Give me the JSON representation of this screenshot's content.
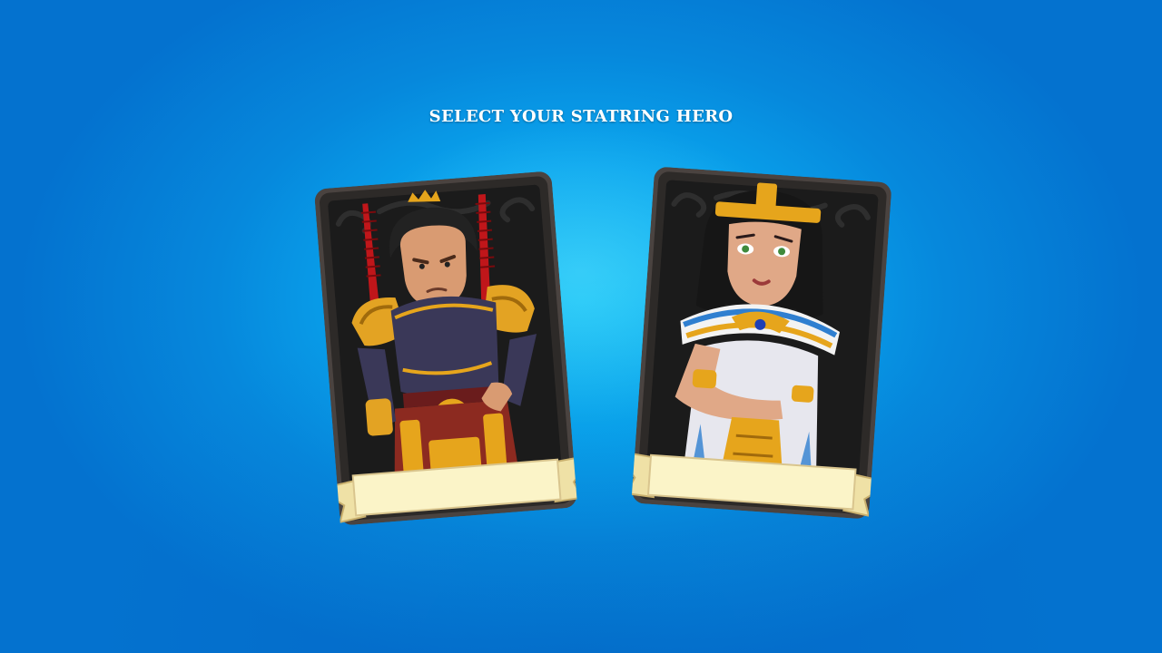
{
  "screen": {
    "title": "SELECT YOUR STATRING HERO"
  },
  "heroes": [
    {
      "id": "warrior",
      "name": "",
      "portrait": "armored-warrior-portrait"
    },
    {
      "id": "queen",
      "name": "",
      "portrait": "egyptian-queen-portrait"
    }
  ],
  "colors": {
    "background_center": "#14c4f6",
    "background_edge": "#0472cf",
    "card_frame": "#3a3532",
    "card_inner": "#1c1c1c",
    "banner_fill": "#fbf4c8",
    "banner_edge": "#d9c58e",
    "gold": "#e6a51c"
  }
}
